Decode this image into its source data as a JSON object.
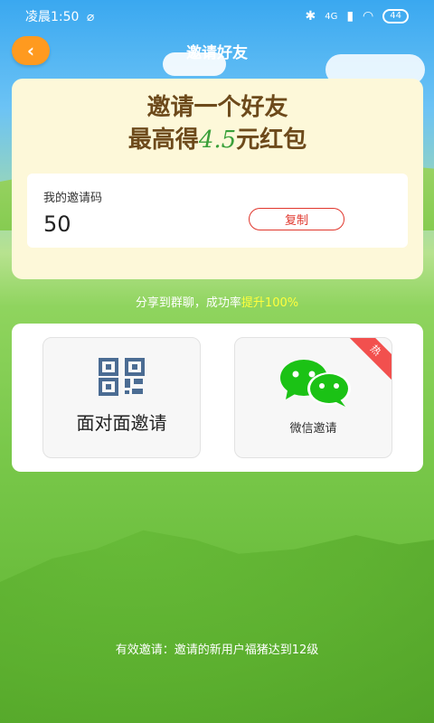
{
  "status": {
    "time": "凌晨1:50",
    "alarm_icon": "alarm-off-icon",
    "network": "4G",
    "battery": "44"
  },
  "header": {
    "title": "邀请好友",
    "back_icon": "back-arrow-icon"
  },
  "invite": {
    "headline1": "邀请一个好友",
    "headline2_prefix": "最高得",
    "headline2_amount": "4.5",
    "headline2_suffix": "元红包",
    "code_label": "我的邀请码",
    "code_value": "50",
    "copy_button": "复制"
  },
  "tip": {
    "text": "分享到群聊，成功率",
    "highlight": "提升100%"
  },
  "share": {
    "face_to_face": "面对面邀请",
    "wechat": "微信邀请",
    "hot_badge": "热"
  },
  "footer": {
    "rule": "有效邀请：邀请的新用户福猪达到12级"
  },
  "colors": {
    "accent_orange": "#ff9a1f",
    "copy_red": "#e0362c",
    "highlight_yellow": "#ffff3c",
    "wechat_green": "#1bc215"
  }
}
